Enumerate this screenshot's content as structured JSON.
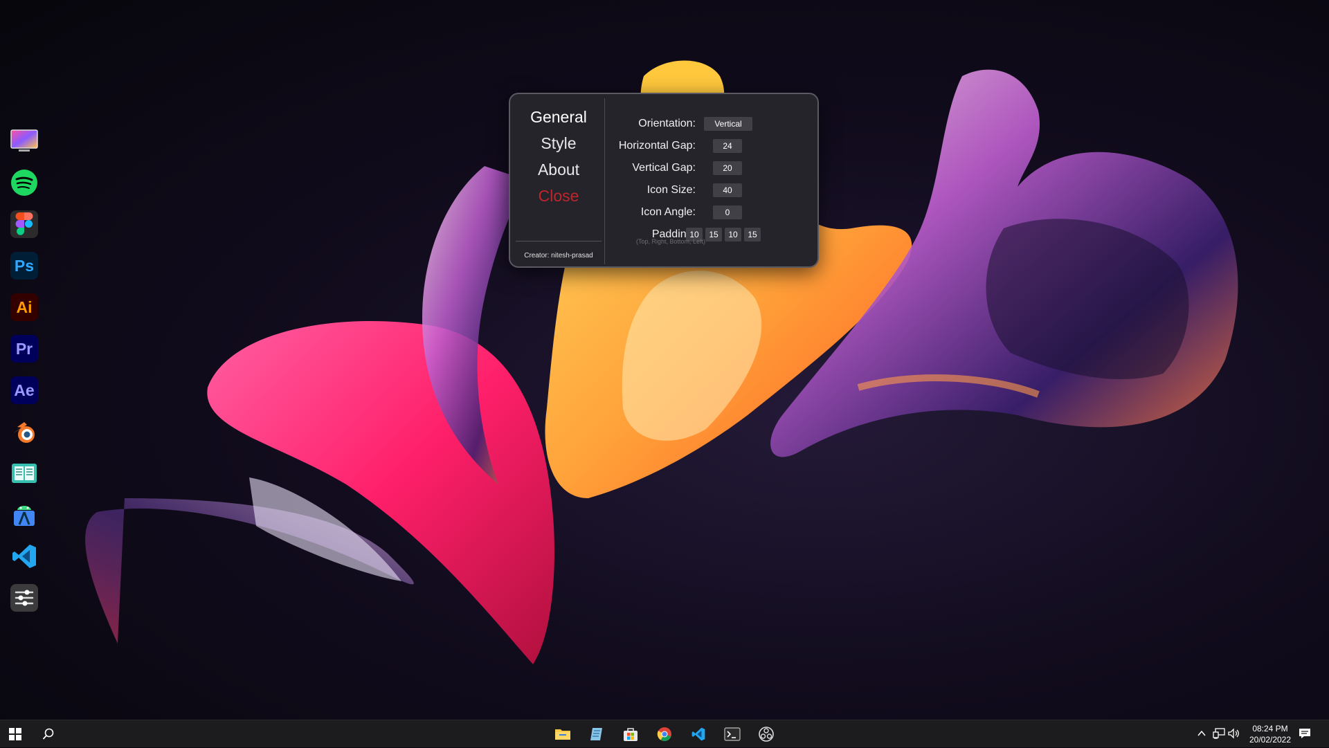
{
  "dock": {
    "items": [
      {
        "name": "display-app"
      },
      {
        "name": "spotify"
      },
      {
        "name": "figma"
      },
      {
        "name": "photoshop",
        "label": "Ps",
        "bg": "#001e36",
        "fg": "#31a8ff"
      },
      {
        "name": "illustrator",
        "label": "Ai",
        "bg": "#330000",
        "fg": "#ff9a00"
      },
      {
        "name": "premiere-pro",
        "label": "Pr",
        "bg": "#00005b",
        "fg": "#9999ff"
      },
      {
        "name": "after-effects",
        "label": "Ae",
        "bg": "#00005b",
        "fg": "#9999ff"
      },
      {
        "name": "blender"
      },
      {
        "name": "reader-app"
      },
      {
        "name": "android-studio"
      },
      {
        "name": "vscode"
      },
      {
        "name": "settings-sliders"
      }
    ]
  },
  "settings": {
    "nav": {
      "general": "General",
      "style": "Style",
      "about": "About",
      "close": "Close"
    },
    "creator": "Creator: nitesh-prasad",
    "fields": {
      "orientation": {
        "label": "Orientation:",
        "value": "Vertical"
      },
      "horizontal_gap": {
        "label": "Horizontal Gap:",
        "value": "24"
      },
      "vertical_gap": {
        "label": "Vertical Gap:",
        "value": "20"
      },
      "icon_size": {
        "label": "Icon Size:",
        "value": "40"
      },
      "icon_angle": {
        "label": "Icon Angle:",
        "value": "0"
      },
      "padding": {
        "label": "Padding:",
        "values": [
          "10",
          "15",
          "10",
          "15"
        ],
        "hint": "(Top, Right, Bottom, Left)"
      }
    }
  },
  "taskbar": {
    "pinned": [
      "file-explorer",
      "notes-app",
      "microsoft-store",
      "chrome",
      "vscode",
      "terminal",
      "obs-studio"
    ],
    "clock": {
      "time": "08:24 PM",
      "date": "20/02/2022"
    }
  },
  "colors": {
    "close_red": "#c0242c",
    "window_bg": "#26242b",
    "taskbar_bg": "#1c1c1e"
  }
}
